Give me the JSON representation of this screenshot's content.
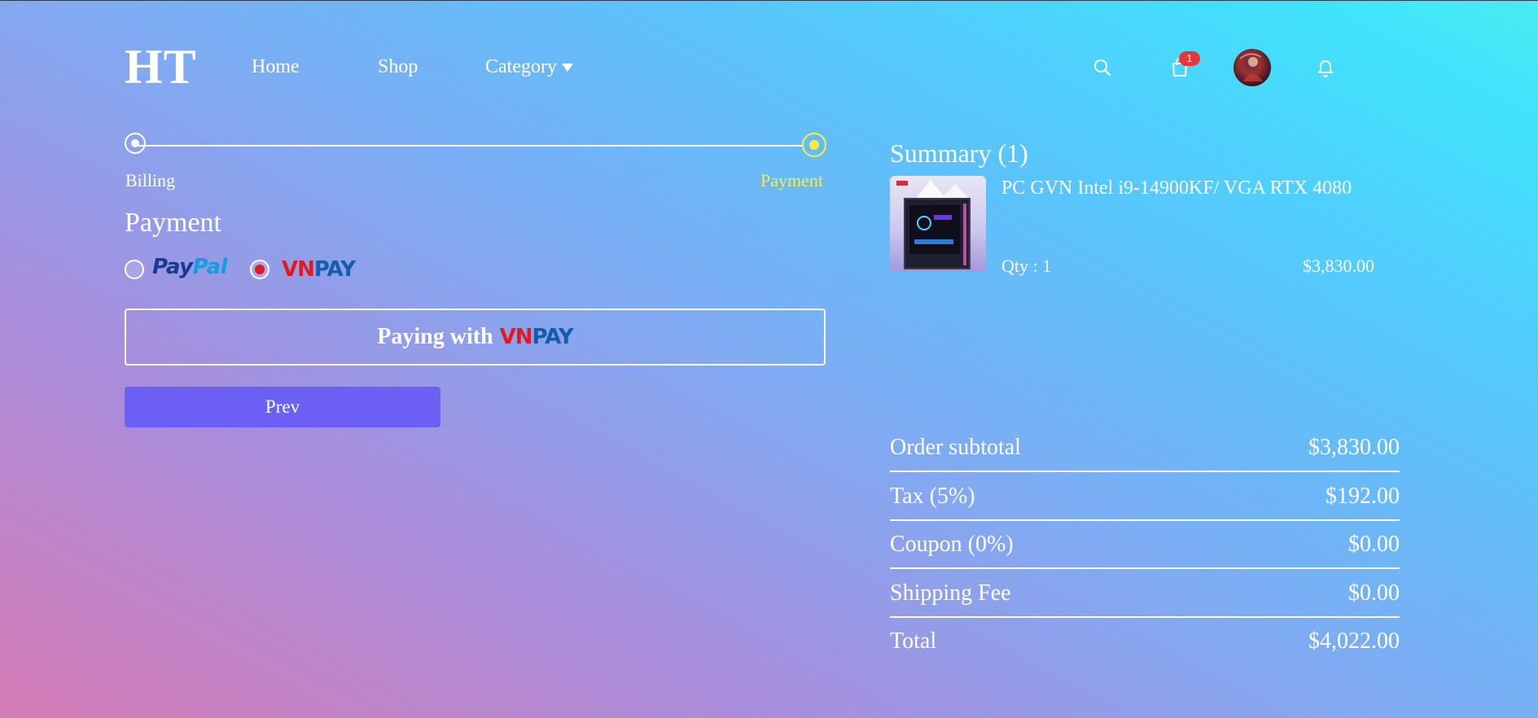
{
  "header": {
    "logo": "HT",
    "nav": {
      "home": "Home",
      "shop": "Shop",
      "category": "Category"
    },
    "cart_count": "1"
  },
  "stepper": {
    "step1": "Billing",
    "step2": "Payment",
    "active_step": 2
  },
  "payment": {
    "title": "Payment",
    "options": [
      {
        "name": "PayPal",
        "parts": [
          "Pay",
          "Pal"
        ],
        "selected": false
      },
      {
        "name": "VNPAY",
        "parts": [
          "VN",
          "PAY"
        ],
        "selected": true
      }
    ],
    "pay_button": {
      "prefix": "Paying with",
      "vn": "VN",
      "pay": "PAY"
    },
    "prev_button": "Prev"
  },
  "summary": {
    "title": "Summary (1)",
    "product": {
      "name": "PC GVN Intel i9-14900KF/ VGA RTX 4080",
      "qty": "Qty : 1",
      "price": "$3,830.00"
    },
    "rows": [
      {
        "label": "Order subtotal",
        "value": "$3,830.00"
      },
      {
        "label": "Tax (5%)",
        "value": "$192.00"
      },
      {
        "label": "Coupon (0%)",
        "value": "$0.00"
      },
      {
        "label": "Shipping Fee",
        "value": "$0.00"
      },
      {
        "label": "Total",
        "value": "$4,022.00"
      }
    ]
  },
  "colors": {
    "accent": "#6c5ff6",
    "step_active": "#ffec3d",
    "badge": "#e5363c",
    "vnpay_red": "#e5181e",
    "vnpay_blue": "#135ea9",
    "paypal_dark": "#1a3a8f",
    "paypal_light": "#159de0"
  },
  "icons": [
    "search-icon",
    "cart-icon",
    "bell-icon",
    "caret-down-icon"
  ]
}
